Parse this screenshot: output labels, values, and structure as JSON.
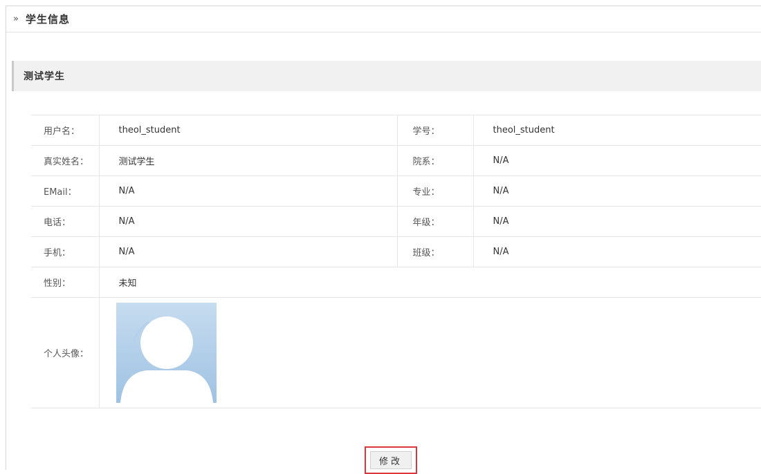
{
  "breadcrumb": {
    "icon": "double-chevron-right-icon",
    "title": "学生信息"
  },
  "section": {
    "title": "测试学生"
  },
  "fields": {
    "username_label": "用户名：",
    "username_value": "theol_student",
    "student_id_label": "学号：",
    "student_id_value": "theol_student",
    "real_name_label": "真实姓名：",
    "real_name_value": "测试学生",
    "department_label": "院系：",
    "department_value": "N/A",
    "email_label": "EMail：",
    "email_value": "N/A",
    "major_label": "专业：",
    "major_value": "N/A",
    "phone_label": "电话：",
    "phone_value": "N/A",
    "grade_label": "年级：",
    "grade_value": "N/A",
    "mobile_label": "手机：",
    "mobile_value": "N/A",
    "class_label": "班级：",
    "class_value": "N/A",
    "gender_label": "性别：",
    "gender_value": "未知",
    "avatar_label": "个人头像："
  },
  "actions": {
    "edit_label": "修改"
  },
  "colors": {
    "highlight_border": "#d9363e",
    "avatar_bg": "#a9c9e6",
    "avatar_figure": "#ffffff"
  }
}
